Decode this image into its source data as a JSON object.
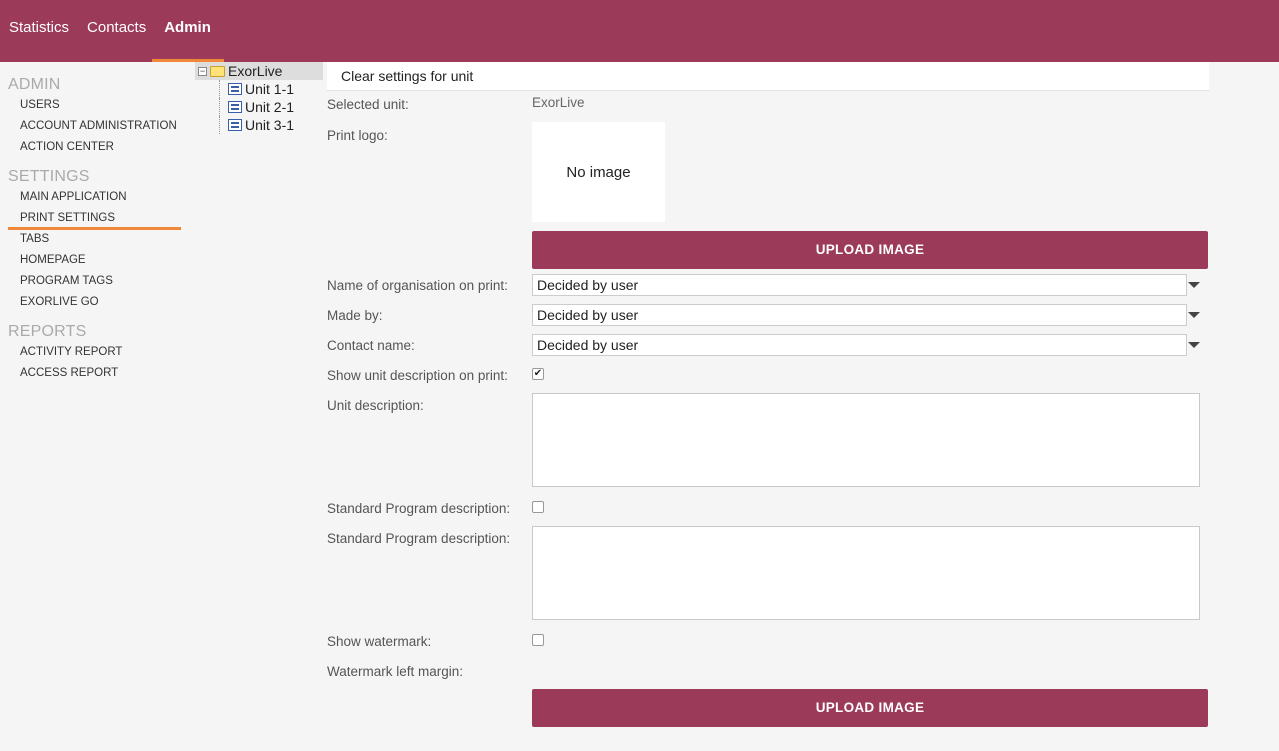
{
  "topnav": {
    "tabs": [
      {
        "label": "Statistics"
      },
      {
        "label": "Contacts"
      },
      {
        "label": "Admin"
      }
    ]
  },
  "sidebar": {
    "admin_title": "ADMIN",
    "admin_items": [
      "USERS",
      "ACCOUNT ADMINISTRATION",
      "ACTION CENTER"
    ],
    "settings_title": "SETTINGS",
    "settings_items": [
      "MAIN APPLICATION",
      "PRINT SETTINGS",
      "TABS",
      "HOMEPAGE",
      "PROGRAM TAGS",
      "EXORLIVE GO"
    ],
    "reports_title": "REPORTS",
    "reports_items": [
      "ACTIVITY REPORT",
      "ACCESS REPORT"
    ]
  },
  "tree": {
    "root": "ExorLive",
    "children": [
      "Unit 1-1",
      "Unit 2-1",
      "Unit 3-1"
    ]
  },
  "main": {
    "header": "Clear settings for unit",
    "selected_unit_label": "Selected unit:",
    "selected_unit_value": "ExorLive",
    "print_logo_label": "Print logo:",
    "no_image_text": "No image",
    "upload_button_1": "UPLOAD IMAGE",
    "org_name_label": "Name of organisation on print:",
    "org_name_value": "Decided by user",
    "made_by_label": "Made by:",
    "made_by_value": "Decided by user",
    "contact_name_label": "Contact name:",
    "contact_name_value": "Decided by user",
    "show_unit_desc_label": "Show unit description on print:",
    "show_unit_desc_checked": true,
    "unit_desc_label": "Unit description:",
    "std_prog_desc_check_label": "Standard Program description:",
    "std_prog_desc_checked": false,
    "std_prog_desc_label": "Standard Program description:",
    "show_watermark_label": "Show watermark:",
    "show_watermark_checked": false,
    "watermark_margin_label": "Watermark left margin:",
    "upload_button_2": "UPLOAD IMAGE"
  },
  "colors": {
    "brand": "#9c3a5a",
    "accent": "#f0883a"
  }
}
